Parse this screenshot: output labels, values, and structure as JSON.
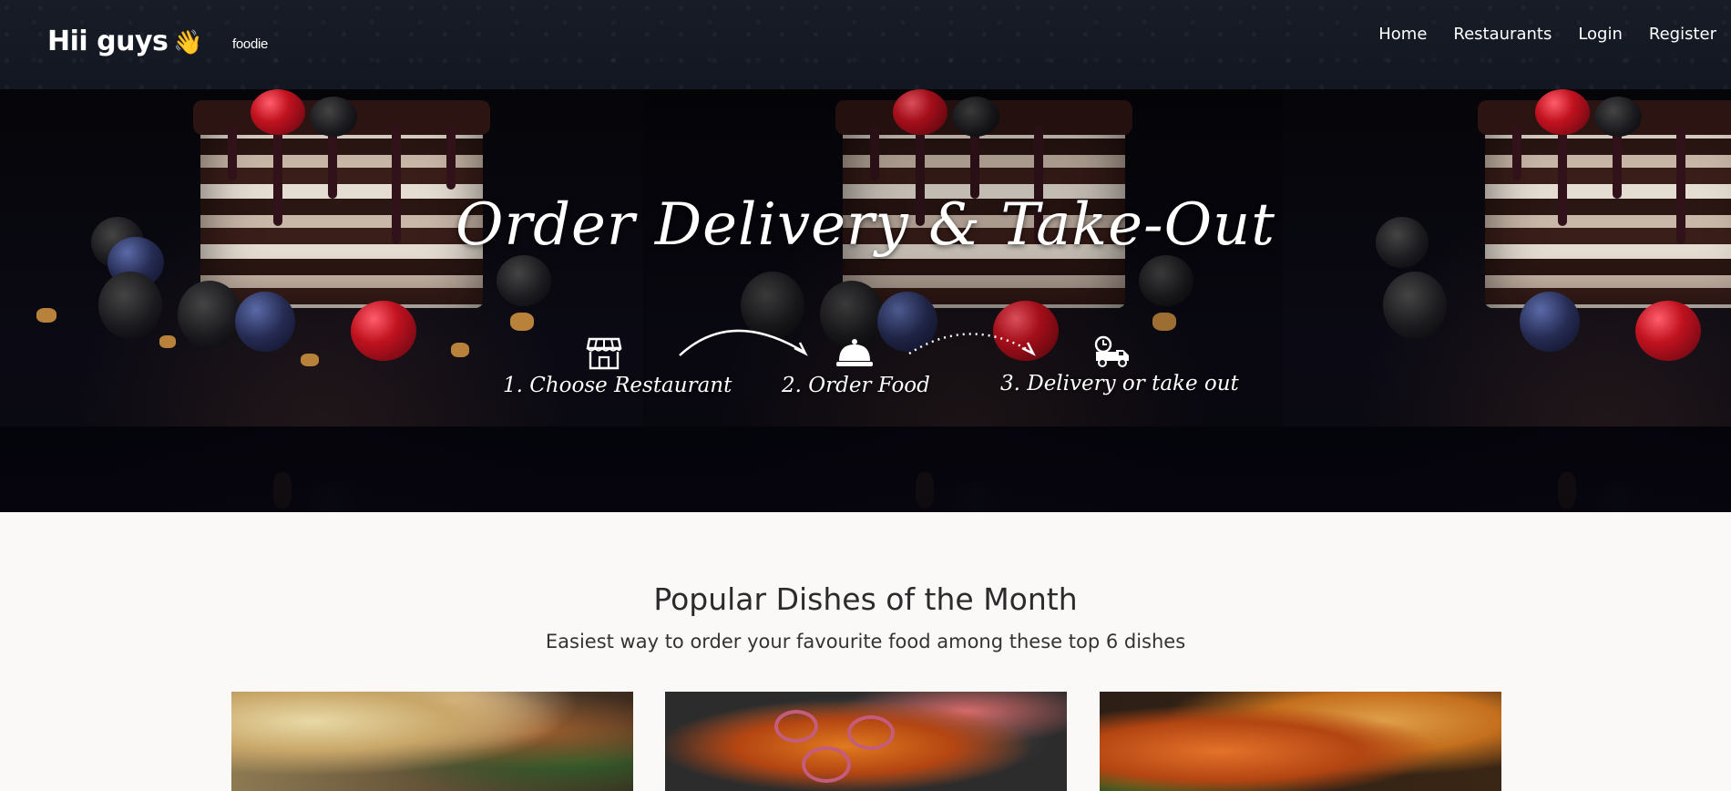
{
  "navbar": {
    "brand": "Hii guys",
    "brand_emoji": "👋",
    "logo_text": "foodie",
    "links": [
      {
        "label": "Home"
      },
      {
        "label": "Restaurants"
      },
      {
        "label": "Login"
      },
      {
        "label": "Register"
      }
    ]
  },
  "hero": {
    "title": "Order Delivery & Take-Out",
    "steps": [
      {
        "label": "1. Choose Restaurant",
        "icon": "store-icon"
      },
      {
        "label": "2. Order Food",
        "icon": "cloche-icon"
      },
      {
        "label": "3. Delivery or take out",
        "icon": "delivery-truck-icon"
      }
    ]
  },
  "popular": {
    "title": "Popular Dishes of the Month",
    "subtitle": "Easiest way to order your favourite food among these top 6 dishes"
  },
  "colors": {
    "navbar_bg": "#151a24",
    "page_bg": "#fbf9f8",
    "text_light": "#ffffff",
    "text_dark": "#2b2b2b"
  }
}
